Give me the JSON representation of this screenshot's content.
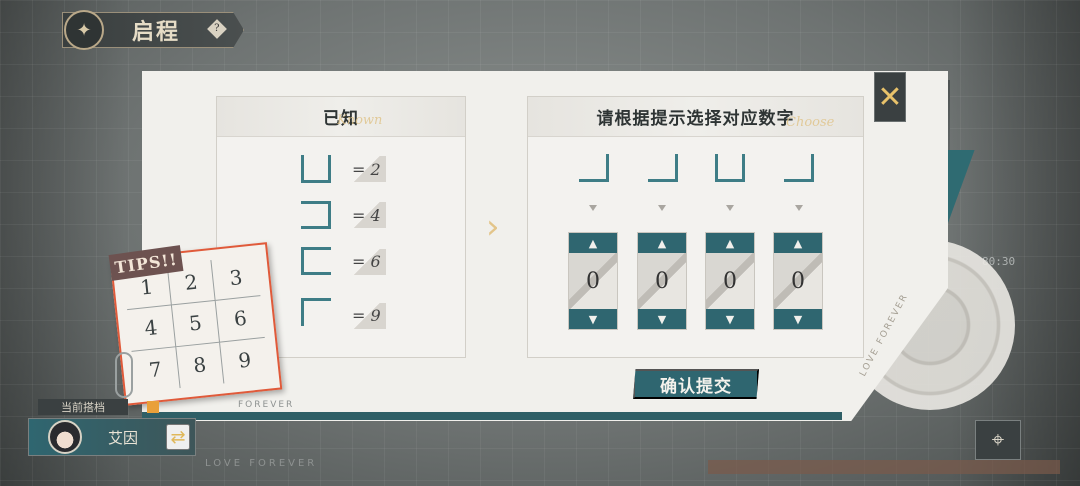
{
  "chapter": {
    "title": "启程",
    "help_icon": "diamond-question-icon"
  },
  "known_panel": {
    "title": "已知",
    "script": "Known",
    "clues": [
      {
        "glyph": "u-shape",
        "equation": "= 2"
      },
      {
        "glyph": "reverse-c-shape",
        "equation": "= 4"
      },
      {
        "glyph": "c-shape",
        "equation": "= 6"
      },
      {
        "glyph": "corner-top-left",
        "equation": "= 9"
      }
    ]
  },
  "choose_panel": {
    "title": "请根据提示选择对应数字",
    "script": "Choose",
    "targets": [
      "corner-bottom-right",
      "corner-bottom-left",
      "u-shape",
      "corner-bottom-left-2"
    ],
    "dials": [
      {
        "value": "0"
      },
      {
        "value": "0"
      },
      {
        "value": "0"
      },
      {
        "value": "0"
      }
    ],
    "submit_label": "确认提交"
  },
  "tips": {
    "tag": "TIPS!!",
    "grid": [
      "1",
      "2",
      "3",
      "4",
      "5",
      "6",
      "7",
      "8",
      "9"
    ]
  },
  "partner": {
    "label": "当前搭档",
    "name": "艾因",
    "swap_icon": "swap-arrows-icon"
  },
  "decor": {
    "love_forever": "LOVE FOREVER",
    "forever_small": "FOREVER",
    "love_forever_vertical": "LOVE FOREVER",
    "time_label": "80:30"
  },
  "colors": {
    "teal": "#2f6670",
    "accent_gold": "#e3c58a",
    "tips_red": "#e05a3a"
  }
}
